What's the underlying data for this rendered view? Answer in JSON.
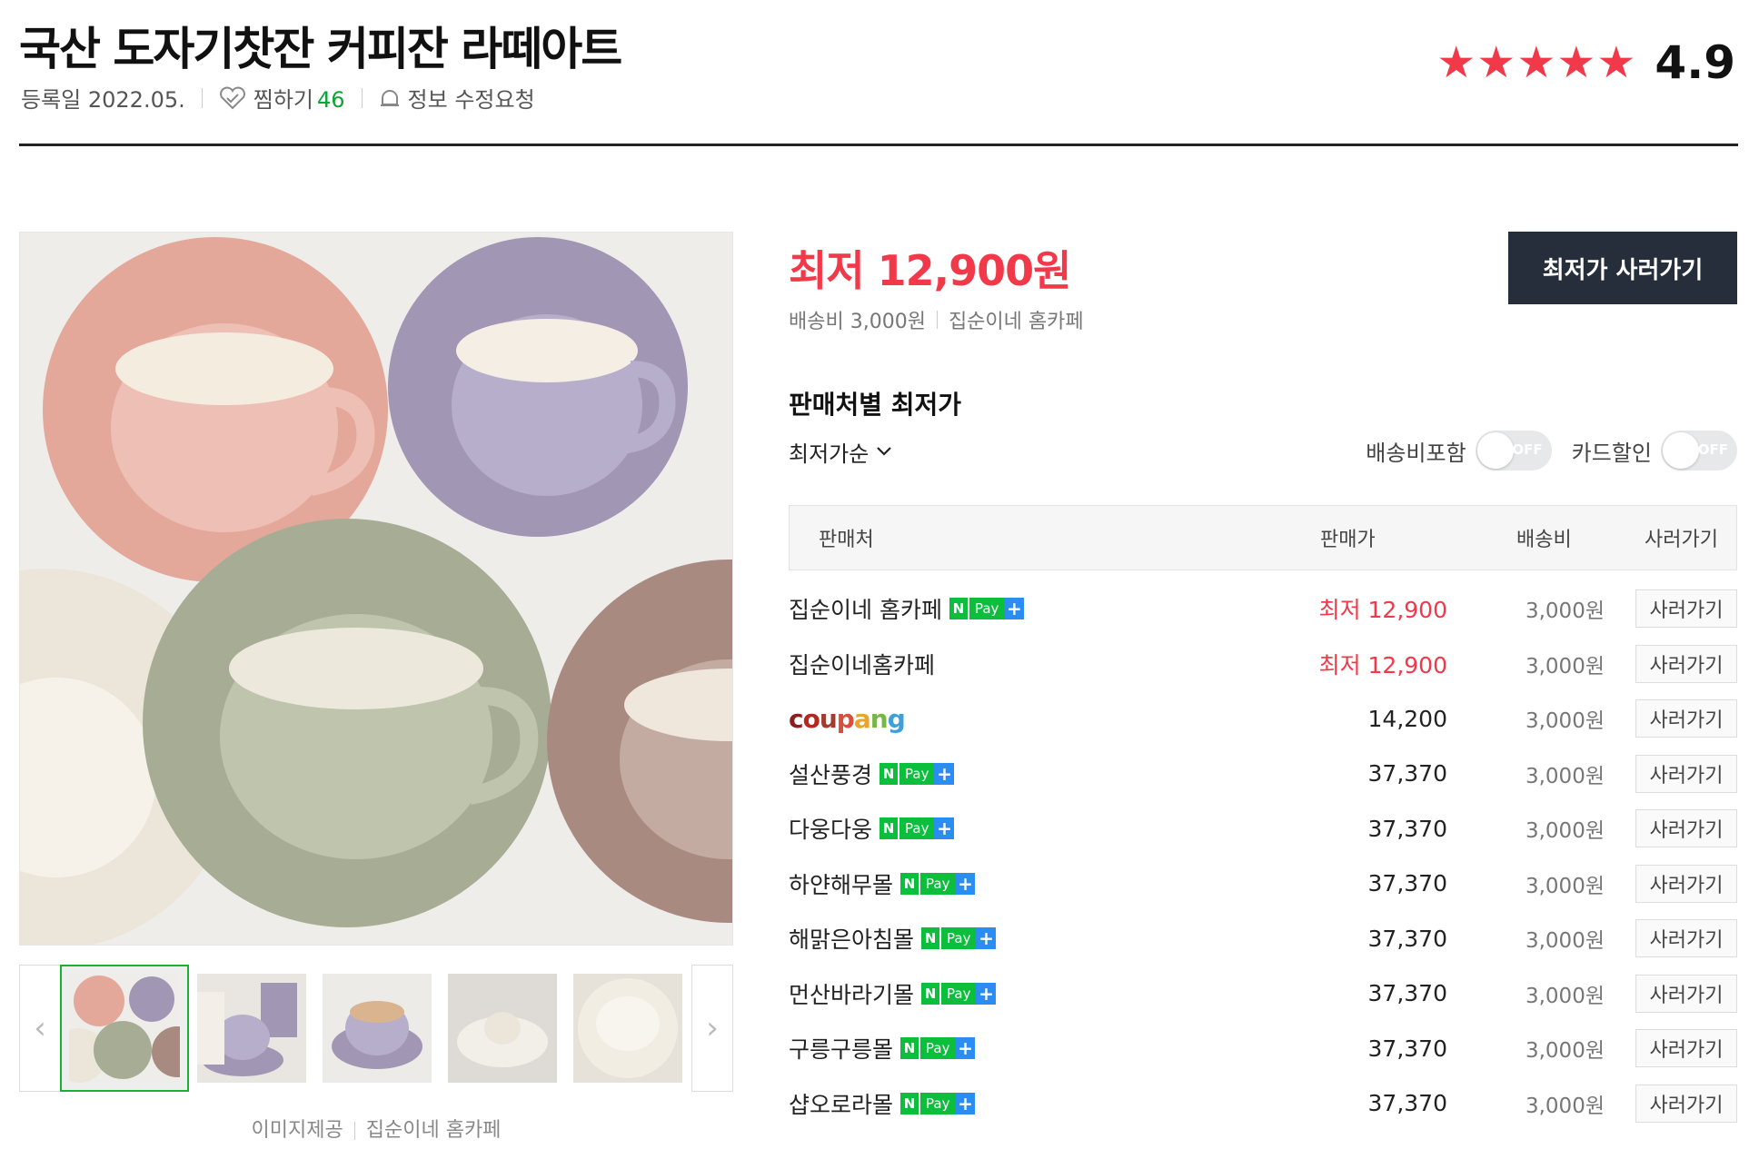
{
  "product": {
    "title": "국산 도자기찻잔 커피잔 라떼아트",
    "registered": "등록일 2022.05.",
    "wish_label": "찜하기",
    "wish_count": "46",
    "report_label": "정보 수정요청",
    "rating": "4.9",
    "stars": 5
  },
  "offer": {
    "lowest_price": "최저 12,900원",
    "shipping": "배송비 3,000원",
    "seller": "집순이네 홈카페",
    "buy_button": "최저가 사러가기"
  },
  "image": {
    "credit_label": "이미지제공",
    "credit_source": "집순이네 홈카페"
  },
  "sellers_section": {
    "title": "판매처별 최저가",
    "sort_label": "최저가순",
    "toggle_shipping": "배송비포함",
    "toggle_card": "카드할인",
    "toggle_state": "OFF",
    "columns": [
      "판매처",
      "판매가",
      "배송비",
      "사러가기"
    ],
    "rows": [
      {
        "seller": "집순이네 홈카페",
        "npay": true,
        "price": "최저 12,900",
        "lowest": true,
        "ship": "3,000원",
        "buy": "사러가기"
      },
      {
        "seller": "집순이네홈카페",
        "npay": false,
        "price": "최저 12,900",
        "lowest": true,
        "ship": "3,000원",
        "buy": "사러가기"
      },
      {
        "seller": "coupang",
        "npay": false,
        "logo": true,
        "price": "14,200",
        "lowest": false,
        "ship": "3,000원",
        "buy": "사러가기"
      },
      {
        "seller": "설산풍경",
        "npay": true,
        "price": "37,370",
        "lowest": false,
        "ship": "3,000원",
        "buy": "사러가기"
      },
      {
        "seller": "다웅다웅",
        "npay": true,
        "price": "37,370",
        "lowest": false,
        "ship": "3,000원",
        "buy": "사러가기"
      },
      {
        "seller": "하얀해무몰",
        "npay": true,
        "price": "37,370",
        "lowest": false,
        "ship": "3,000원",
        "buy": "사러가기"
      },
      {
        "seller": "해맑은아침몰",
        "npay": true,
        "price": "37,370",
        "lowest": false,
        "ship": "3,000원",
        "buy": "사러가기"
      },
      {
        "seller": "먼산바라기몰",
        "npay": true,
        "price": "37,370",
        "lowest": false,
        "ship": "3,000원",
        "buy": "사러가기"
      },
      {
        "seller": "구릉구릉몰",
        "npay": true,
        "price": "37,370",
        "lowest": false,
        "ship": "3,000원",
        "buy": "사러가기"
      },
      {
        "seller": "샵오로라몰",
        "npay": true,
        "price": "37,370",
        "lowest": false,
        "ship": "3,000원",
        "buy": "사러가기"
      }
    ],
    "npay_text": "Pay",
    "npay_n": "N",
    "npay_plus": "+"
  },
  "colors": {
    "accent_red": "#f2394a",
    "npay_green": "#0bbe3b",
    "npay_blue": "#2b8cf2",
    "dark_button": "#262d3b"
  }
}
